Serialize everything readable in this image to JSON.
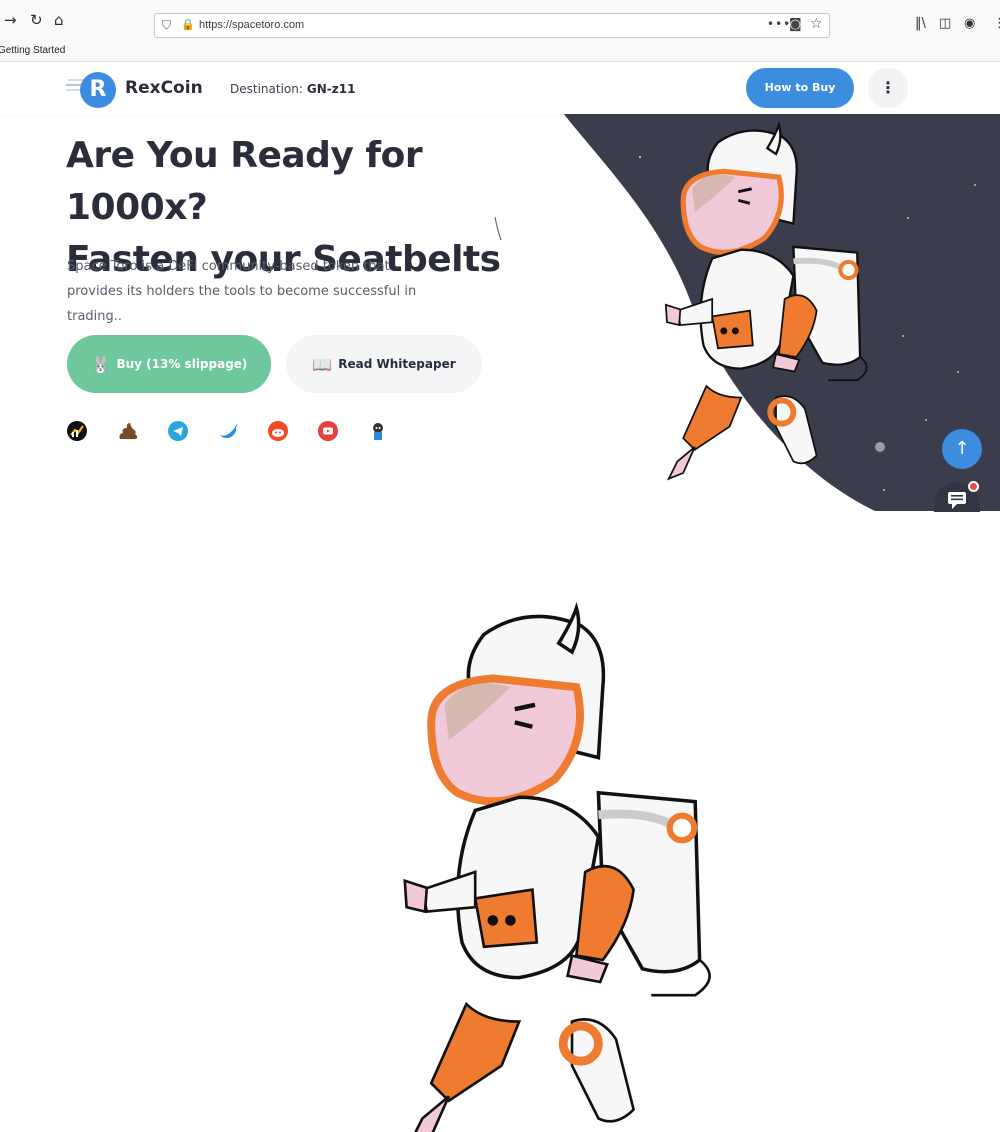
{
  "browser": {
    "url": "https://spacetoro.com",
    "bookmark": "Getting Started"
  },
  "header": {
    "logo_text": "RexCoin",
    "logo_letter": "R",
    "destination_label": "Destination:",
    "destination_value": "GN-z11",
    "how_to_buy": "How to Buy",
    "more_icon": "⋮"
  },
  "hero": {
    "title_line1": "Are You Ready for 1000x?",
    "title_line2": "Fasten your Seatbelts",
    "description": "Space Toro is a DeFI community-based token that provides its holders the tools to become successful in trading..",
    "buy_label": "Buy (13% slippage)",
    "whitepaper_label": "Read Whitepaper"
  },
  "social_icons": [
    "chart-icon",
    "poocoin-icon",
    "telegram-icon",
    "twitter-icon",
    "reddit-icon",
    "youtube-icon",
    "github-icon"
  ],
  "colors": {
    "accent_blue": "#3c8ddf",
    "buy_green": "#6ec79d",
    "space_dark": "#3b3d4c",
    "suit_orange": "#ee7b30"
  }
}
